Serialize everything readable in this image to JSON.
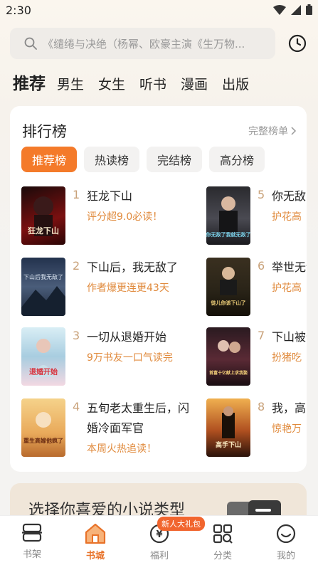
{
  "status": {
    "time": "2:30"
  },
  "search": {
    "placeholder": "《缱绻与决绝（杨幂、欧豪主演《生万物..."
  },
  "category_tabs": [
    {
      "label": "推荐",
      "active": true
    },
    {
      "label": "男生"
    },
    {
      "label": "女生"
    },
    {
      "label": "听书"
    },
    {
      "label": "漫画"
    },
    {
      "label": "出版"
    }
  ],
  "ranking": {
    "title": "排行榜",
    "more_label": "完整榜单",
    "tabs": [
      "推荐榜",
      "热读榜",
      "完结榜",
      "高分榜"
    ],
    "books": [
      {
        "rank": "1",
        "title": "狂龙下山",
        "desc": "评分超9.0必读！",
        "cover_text": "狂龙下山"
      },
      {
        "rank": "2",
        "title": "下山后，我无敌了",
        "desc": "作者爆更连更43天",
        "cover_text": "下山后我无敌了"
      },
      {
        "rank": "3",
        "title": "一切从退婚开始",
        "desc": "9万书友一口气读完",
        "cover_text": "退婚开始"
      },
      {
        "rank": "4",
        "title": "五旬老太重生后，闪婚冷面军官",
        "desc": "本周火热追读！",
        "cover_text": "重生高嫁他疯了"
      },
      {
        "rank": "5",
        "title": "你无敌",
        "desc": "护花高",
        "cover_text": "你无敌了我就无敌了"
      },
      {
        "rank": "6",
        "title": "举世无该下山",
        "desc": "护花高",
        "cover_text": "徒儿你该下山了"
      },
      {
        "rank": "7",
        "title": "下山被十亿献",
        "desc": "扮猪吃",
        "cover_text": "首富十亿献上求我娶"
      },
      {
        "rank": "8",
        "title": "我，高",
        "desc": "惊艳万",
        "cover_text": "高手下山"
      }
    ]
  },
  "genre_banner": {
    "text": "选择你喜爱的小说类型"
  },
  "bottom_nav": [
    {
      "label": "书架",
      "icon": "bookshelf-icon"
    },
    {
      "label": "书城",
      "icon": "bookstore-icon",
      "active": true
    },
    {
      "label": "福利",
      "icon": "welfare-icon"
    },
    {
      "label": "分类",
      "icon": "category-icon"
    },
    {
      "label": "我的",
      "icon": "profile-icon"
    }
  ],
  "nav_badge": "新人大礼包",
  "colors": {
    "accent": "#f47a2a",
    "desc_orange": "#e08a3c",
    "rank_num": "#c9a27a"
  }
}
